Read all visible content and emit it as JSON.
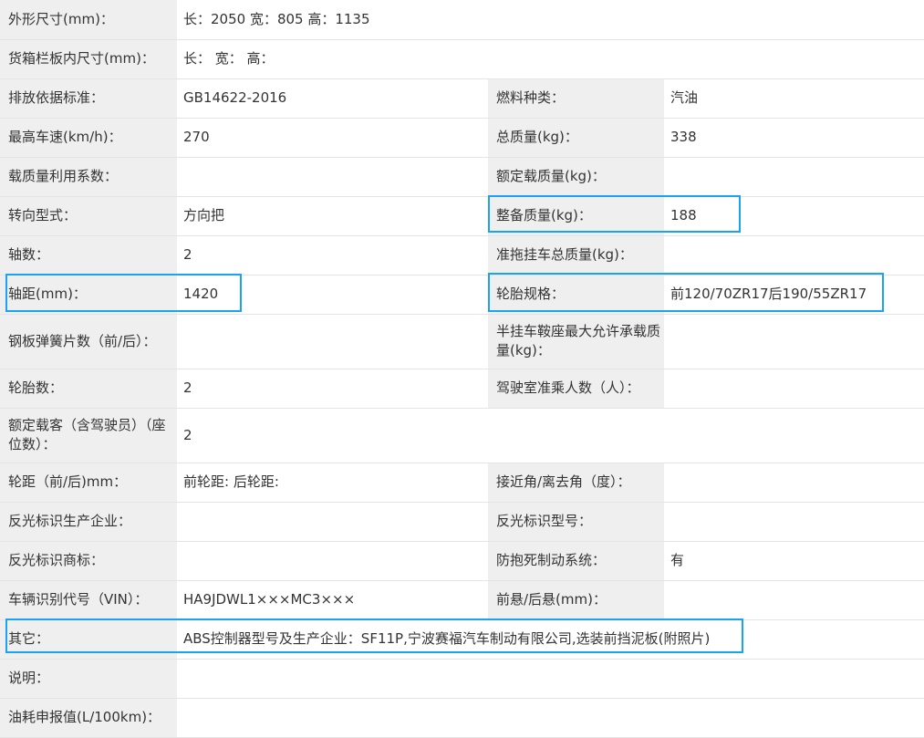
{
  "rows": [
    {
      "l1": "外形尺寸(mm)：",
      "v1": "长：2050 宽：805 高：1135",
      "l2": "",
      "v2": ""
    },
    {
      "l1": "货箱栏板内尺寸(mm)：",
      "v1": "长： 宽： 高：",
      "l2": "",
      "v2": ""
    },
    {
      "l1": "排放依据标准：",
      "v1": "GB14622-2016",
      "l2": "燃料种类：",
      "v2": "汽油"
    },
    {
      "l1": "最高车速(km/h)：",
      "v1": "270",
      "l2": "总质量(kg)：",
      "v2": "338"
    },
    {
      "l1": "载质量利用系数：",
      "v1": "",
      "l2": "额定载质量(kg)：",
      "v2": ""
    },
    {
      "l1": "转向型式：",
      "v1": "方向把",
      "l2": "整备质量(kg)：",
      "v2": "188"
    },
    {
      "l1": "轴数：",
      "v1": "2",
      "l2": "准拖挂车总质量(kg)：",
      "v2": ""
    },
    {
      "l1": "轴距(mm)：",
      "v1": "1420",
      "l2": "轮胎规格：",
      "v2": "前120/70ZR17后190/55ZR17"
    },
    {
      "l1": "钢板弹簧片数（前/后）：",
      "v1": "",
      "l2": "半挂车鞍座最大允许承载质量(kg)：",
      "v2": ""
    },
    {
      "l1": "轮胎数：",
      "v1": "2",
      "l2": "驾驶室准乘人数（人）：",
      "v2": ""
    },
    {
      "l1": "额定载客（含驾驶员）（座位数）：",
      "v1": "2",
      "l2": "",
      "v2": ""
    },
    {
      "l1": "轮距（前/后)mm：",
      "v1": "前轮距: 后轮距:",
      "l2": "接近角/离去角（度）：",
      "v2": ""
    },
    {
      "l1": "反光标识生产企业：",
      "v1": "",
      "l2": "反光标识型号：",
      "v2": ""
    },
    {
      "l1": "反光标识商标：",
      "v1": "",
      "l2": "防抱死制动系统：",
      "v2": "有"
    },
    {
      "l1": "车辆识别代号（VIN）：",
      "v1": "HA9JDWL1×××MC3×××",
      "l2": "前悬/后悬(mm)：",
      "v2": ""
    },
    {
      "l1": "其它：",
      "v1": "ABS控制器型号及生产企业：SF11P,宁波赛福汽车制动有限公司,选装前挡泥板(附照片)",
      "l2": "",
      "v2": ""
    },
    {
      "l1": "说明：",
      "v1": "",
      "l2": "",
      "v2": ""
    },
    {
      "l1": "油耗申报值(L/100km)：",
      "v1": "",
      "l2": "",
      "v2": ""
    }
  ],
  "highlight_color": "#1aa3f0"
}
